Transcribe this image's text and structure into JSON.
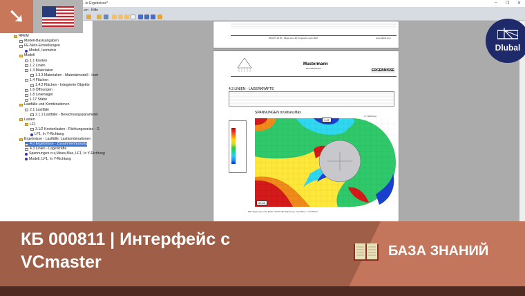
{
  "window": {
    "title": "... te Ergebnisse*",
    "controls": [
      "–",
      "❐",
      "✕"
    ]
  },
  "menu": [
    "...en",
    "Hilfe"
  ],
  "tree": [
    {
      "label": "RFEM",
      "level": 0,
      "icon": "folder"
    },
    {
      "label": "Modell-Basisangaben",
      "level": 1,
      "icon": "table"
    },
    {
      "label": "FE-Netz-Einstellungen",
      "level": 1,
      "icon": "table"
    },
    {
      "label": "Modell, Isometrie",
      "level": 2,
      "icon": "model"
    },
    {
      "label": "Modell",
      "level": 1,
      "icon": "folder"
    },
    {
      "label": "1.1 Knoten",
      "level": 2,
      "icon": "table"
    },
    {
      "label": "1.2 Linien",
      "level": 2,
      "icon": "table"
    },
    {
      "label": "1.3 Materialien",
      "level": 2,
      "icon": "table"
    },
    {
      "label": "1.3.3 Materialien - Materialmodell - Isotr",
      "level": 3,
      "icon": "table"
    },
    {
      "label": "1.4 Flächen",
      "level": 2,
      "icon": "table"
    },
    {
      "label": "1.4.2 Flächen - Integrierte Objekte",
      "level": 3,
      "icon": "table"
    },
    {
      "label": "1.6 Öffnungen",
      "level": 2,
      "icon": "table"
    },
    {
      "label": "1.8 Linienlager",
      "level": 2,
      "icon": "table"
    },
    {
      "label": "1.17 Stäbe",
      "level": 2,
      "icon": "table"
    },
    {
      "label": "Lastfälle und Kombinationen",
      "level": 1,
      "icon": "folder"
    },
    {
      "label": "2.1 Lastfälle",
      "level": 2,
      "icon": "table"
    },
    {
      "label": "2.1.1 Lastfälle - Berechnungsparameter",
      "level": 3,
      "icon": "table"
    },
    {
      "label": "Lasten",
      "level": 1,
      "icon": "folder"
    },
    {
      "label": "LF1",
      "level": 2,
      "icon": "folder"
    },
    {
      "label": "3.1/2 Knotenlasten - Richtungsweise - G",
      "level": 3,
      "icon": "table"
    },
    {
      "label": "LF1, In Y-Richtung",
      "level": 3,
      "icon": "model"
    },
    {
      "label": "Ergebnisse - Lastfälle, Lastkombinationen",
      "level": 1,
      "icon": "folder"
    },
    {
      "label": "4.0 Ergebnisse - Zusammenfassung",
      "level": 2,
      "icon": "table",
      "selected": true
    },
    {
      "label": "4.3 Linien - Lagerkräfte",
      "level": 2,
      "icon": "table"
    },
    {
      "label": "Spannungen σ-v,Mises,Max, LF1, In Y-Richtung",
      "level": 2,
      "icon": "model"
    },
    {
      "label": "Modell, LF1, In Y-Richtung",
      "level": 2,
      "icon": "model"
    }
  ],
  "report": {
    "footer": "RFEM 5.26.00 - Allgemeine 3D-Tragwerke nach FEM",
    "footer_url": "www.dlubal.com",
    "company": "Mustermann",
    "city": "MUSTERSTADT",
    "section_badge": "ERGEBNISSE",
    "section1": "4.3 LINIEN - LAGERKRÄFTE",
    "section2": "SPANNUNGEN σv,Mises,Max",
    "max_label": "1.47",
    "min_label": "23.50",
    "plot_caption": "Max Sigma-eqv.,max,Mises: 23.50, Min Sigma-eqv.,max,Mises: 1.47 kN/cm²",
    "direction": "In Y-Richtung"
  },
  "brand": {
    "name": "Dlubal"
  },
  "banner": {
    "title": "КБ 000811 | Интерфейс с VCmaster",
    "category": "БАЗА ЗНАНИЙ"
  },
  "colors": {
    "banner_left": "#9e5e48",
    "banner_right": "#c4765c",
    "banner_bottom": "#4e2a20",
    "brand": "#1f2a6b"
  }
}
